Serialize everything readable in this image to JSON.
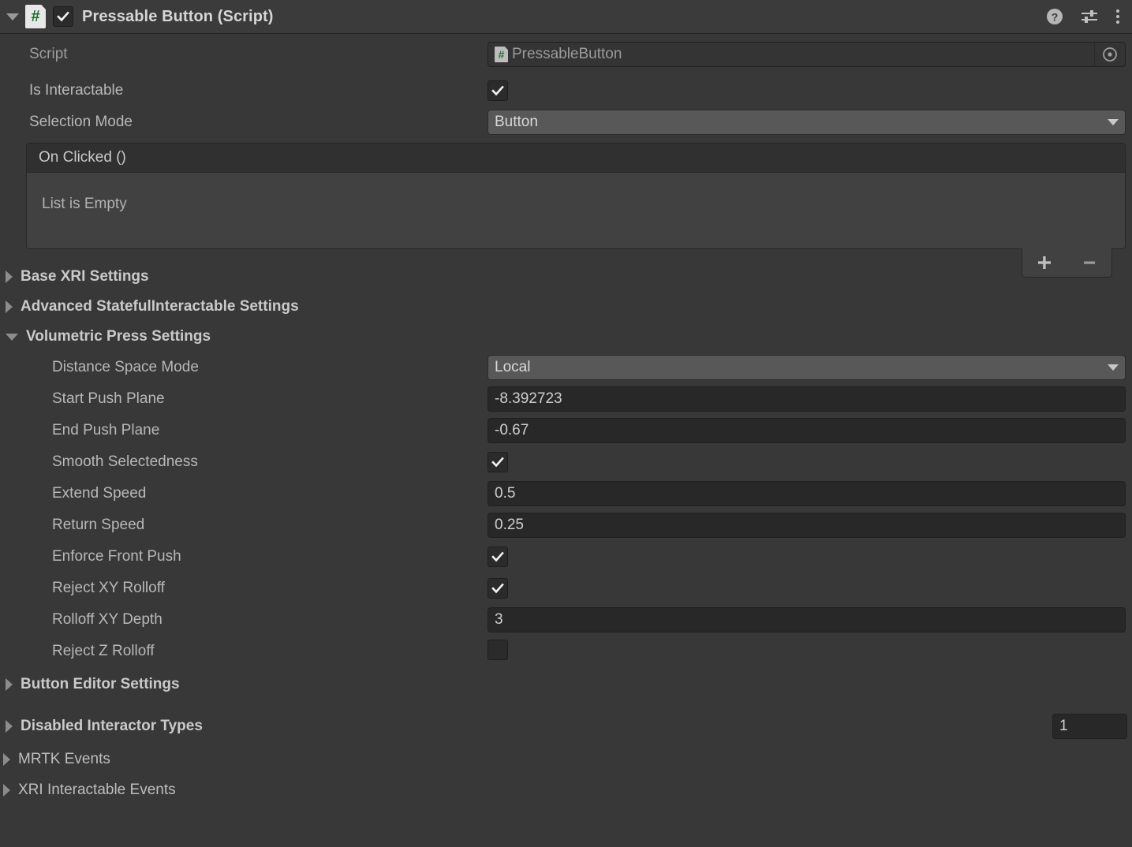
{
  "component": {
    "title": "Pressable Button (Script)",
    "enabled": true,
    "script_icon": "csharp-script-icon",
    "header_buttons": [
      {
        "name": "help-icon",
        "label": "?"
      },
      {
        "name": "preset-icon",
        "label": ""
      },
      {
        "name": "more-menu-icon",
        "label": ""
      }
    ]
  },
  "fields": {
    "script": {
      "label": "Script",
      "value": "PressableButton"
    },
    "is_interactable": {
      "label": "Is Interactable",
      "value": true
    },
    "selection_mode": {
      "label": "Selection Mode",
      "value": "Button"
    }
  },
  "event_list": {
    "header": "On Clicked ()",
    "empty_text": "List is Empty",
    "add_label": "+",
    "remove_label": "–"
  },
  "sections": [
    {
      "label": "Base XRI Settings",
      "expanded": false,
      "bold": true
    },
    {
      "label": "Advanced StatefulInteractable Settings",
      "expanded": false,
      "bold": true
    },
    {
      "label": "Volumetric Press Settings",
      "expanded": true,
      "bold": true
    }
  ],
  "volumetric": [
    {
      "label": "Distance Space Mode",
      "type": "popup",
      "value": "Local"
    },
    {
      "label": "Start Push Plane",
      "type": "number",
      "value": "-8.392723"
    },
    {
      "label": "End Push Plane",
      "type": "number",
      "value": "-0.67"
    },
    {
      "label": "Smooth Selectedness",
      "type": "toggle",
      "value": true
    },
    {
      "label": "Extend Speed",
      "type": "number",
      "value": "0.5"
    },
    {
      "label": "Return Speed",
      "type": "number",
      "value": "0.25"
    },
    {
      "label": "Enforce Front Push",
      "type": "toggle",
      "value": true
    },
    {
      "label": "Reject XY Rolloff",
      "type": "toggle",
      "value": true
    },
    {
      "label": "Rolloff XY Depth",
      "type": "number",
      "value": "3"
    },
    {
      "label": "Reject Z Rolloff",
      "type": "toggle",
      "value": false
    }
  ],
  "button_editor_settings": {
    "label": "Button Editor Settings",
    "expanded": false
  },
  "disabled_interactor_types": {
    "label": "Disabled Interactor Types",
    "expanded": false,
    "size_value": "1"
  },
  "bottom_sections": [
    {
      "label": "MRTK Events",
      "expanded": false
    },
    {
      "label": "XRI Interactable Events",
      "expanded": false
    }
  ],
  "colors": {
    "background": "#383838",
    "header": "#3b3b3b",
    "field": "#282828",
    "popup": "#585858",
    "event_box": "#414141",
    "script_green": "#1a6b2e"
  }
}
